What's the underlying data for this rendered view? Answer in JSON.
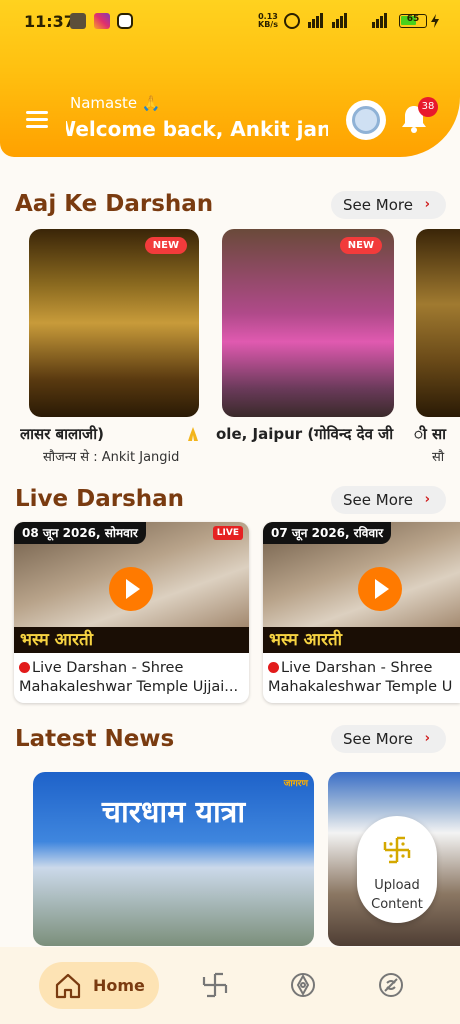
{
  "status_bar": {
    "time": "11:37",
    "net_speed": "0.13",
    "net_unit": "KB/s",
    "battery": "65"
  },
  "header": {
    "greeting": "Namaste 🙏",
    "welcome": "Welcome back, Ankit jangir",
    "notification_count": "38"
  },
  "sections": {
    "darshan": {
      "title": "Aaj Ke Darshan",
      "see_more": "See More"
    },
    "live": {
      "title": "Live Darshan",
      "see_more": "See More"
    },
    "news": {
      "title": "Latest News",
      "see_more": "See More"
    }
  },
  "darshan_cards": [
    {
      "name": "लासर बालाजी)",
      "courtesy": "सौजन्य से : Ankit Jangid",
      "tag": "NEW"
    },
    {
      "name": "ole, Jaipur (गोविन्द देव जी म",
      "courtesy": "",
      "tag": "NEW"
    },
    {
      "name": "ी सा",
      "courtesy": "सौ",
      "tag": ""
    }
  ],
  "live_cards": [
    {
      "date": "08 जून 2026, सोमवार",
      "live_tag": "LIVE",
      "caption": "भस्म आरती",
      "line1": "Live Darshan - Shree",
      "line2": "Mahakaleshwar Temple Ujjai..."
    },
    {
      "date": "07 जून 2026, रविवार",
      "live_tag": "",
      "caption": "भस्म आरती",
      "line1": "Live Darshan - Shree",
      "line2": "Mahakaleshwar Temple U"
    }
  ],
  "news_cards": [
    {
      "headline": "चारधाम यात्रा",
      "source": "जागरण"
    }
  ],
  "upload": {
    "line1": "Upload",
    "line2": "Content"
  },
  "bottom_nav": {
    "home_label": "Home"
  },
  "colors": {
    "accent": "#ffa100",
    "title": "#7a3b10",
    "badge": "#e8192c",
    "nav_active": "#fde3b4"
  }
}
